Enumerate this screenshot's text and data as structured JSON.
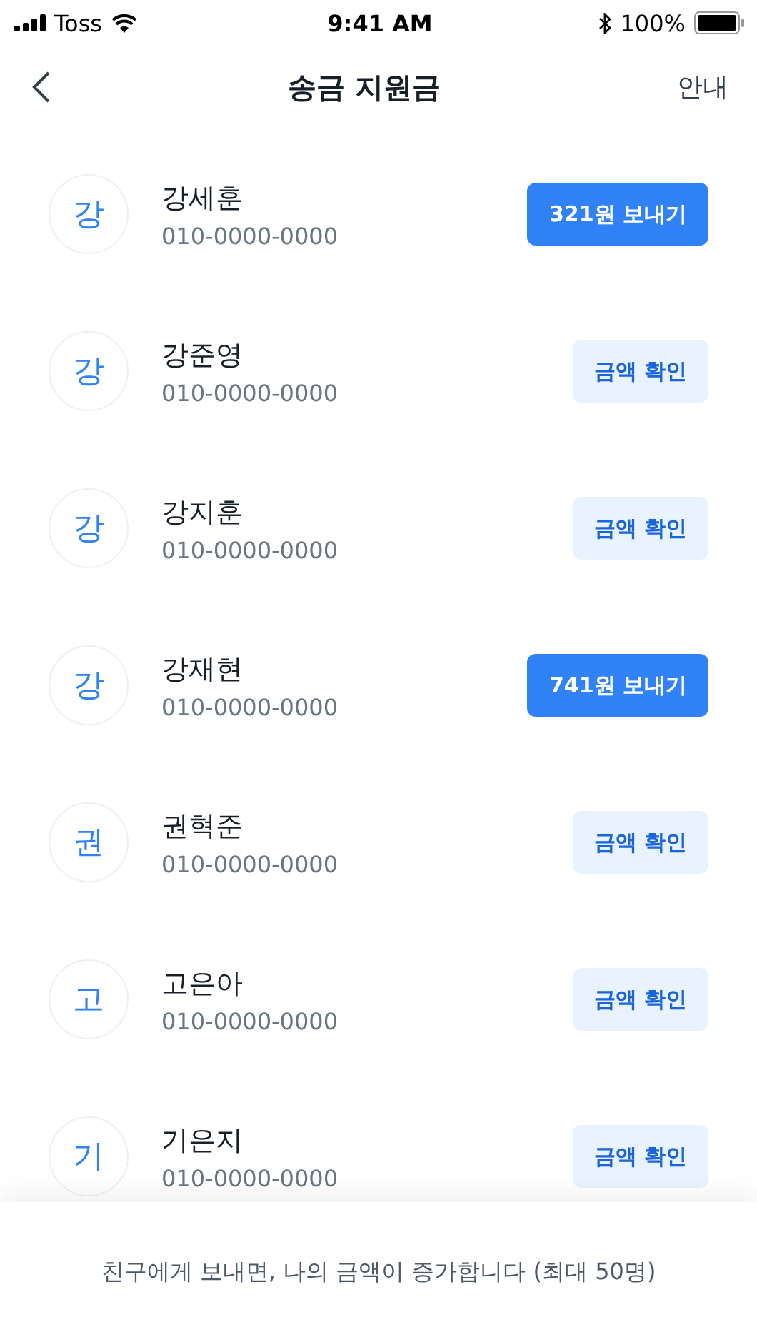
{
  "status_bar": {
    "carrier": "Toss",
    "time": "9:41 AM",
    "battery": "100%"
  },
  "nav": {
    "title": "송금 지원금",
    "action": "안내"
  },
  "contacts": [
    {
      "initial": "강",
      "name": "강세훈",
      "phone": "010-0000-0000",
      "kind": "send",
      "button": "321원 보내기"
    },
    {
      "initial": "강",
      "name": "강준영",
      "phone": "010-0000-0000",
      "kind": "check",
      "button": "금액 확인"
    },
    {
      "initial": "강",
      "name": "강지훈",
      "phone": "010-0000-0000",
      "kind": "check",
      "button": "금액 확인"
    },
    {
      "initial": "강",
      "name": "강재현",
      "phone": "010-0000-0000",
      "kind": "send",
      "button": "741원 보내기"
    },
    {
      "initial": "권",
      "name": "권혁준",
      "phone": "010-0000-0000",
      "kind": "check",
      "button": "금액 확인"
    },
    {
      "initial": "고",
      "name": "고은아",
      "phone": "010-0000-0000",
      "kind": "check",
      "button": "금액 확인"
    },
    {
      "initial": "기",
      "name": "기은지",
      "phone": "010-0000-0000",
      "kind": "check",
      "button": "금액 확인"
    }
  ],
  "footer": "친구에게 보내면, 나의 금액이 증가합니다 (최대 50명)"
}
